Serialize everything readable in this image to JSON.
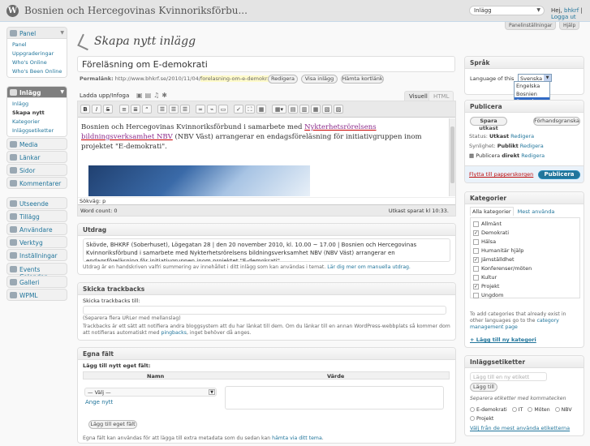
{
  "header": {
    "site_title": "Bosnien och Hercegovinas Kvinnoriksförbu...",
    "favorites_selected": "Inlägg",
    "howdy_prefix": "Hej,",
    "username": "bhkrf",
    "separator": "|",
    "logout": "Logga ut",
    "screen_options": "Panelinställningar",
    "help": "Hjälp"
  },
  "menu": {
    "panel": {
      "label": "Panel",
      "items": [
        "Panel",
        "Uppgraderingar",
        "Who's Online",
        "Who's Been Online"
      ]
    },
    "posts": {
      "label": "Inlägg",
      "items": [
        "Inlägg",
        "Skapa nytt",
        "Kategorier",
        "Inläggsetiketter"
      ]
    },
    "media": "Media",
    "links": "Länkar",
    "pages": "Sidor",
    "comments": "Kommentarer",
    "appearance": "Utseende",
    "plugins": "Tillägg",
    "users": "Användare",
    "tools": "Verktyg",
    "settings": "Inställningar",
    "events": "Events Calendar",
    "gallery": "Galleri",
    "wpml": "WPML"
  },
  "page": {
    "title": "Skapa nytt inlägg",
    "post_title": "Föreläsning om E-demokrati",
    "permalink_label": "Permalänk:",
    "permalink_base": "http://www.bhkrf.se/2010/11/04/",
    "permalink_slug": "forelasning-om-e-demokrati",
    "permalink_end": "/",
    "edit_btn": "Redigera",
    "view_btn": "Visa inlägg",
    "shortlink_btn": "Hämta kortlänk",
    "upload_label": "Ladda upp/Infoga",
    "tab_visual": "Visuell",
    "tab_html": "HTML"
  },
  "editor": {
    "content_1": "Bosnien och Hercegovinas Kvinnoriksförbund i samarbete med",
    "content_link": "Nykterhetsrörelsens bildningsverksamhet NBV",
    "content_2": "(NBV Väst) arrangerar en endagsföreläsning för initiativgruppen inom projektet \"E-demokrati\".",
    "path": "Sökväg: p",
    "word_count": "Word count: 0",
    "draft_saved": "Utkast sparat kl 10:33."
  },
  "excerpt": {
    "title": "Utdrag",
    "text": "Skövde, BHKRF (Soberhuset), Lögegatan 28 | den 20 november 2010, kl. 10.00 ~ 17.00 | Bosnien och Hercegovinas Kvinnoriksförbund i samarbete med Nykterhetsrörelsens bildningsverksamhet NBV (NBV Väst) arrangerar en endagsföreläsning för initiativgruppen inom projektet \"E-demokrati\".",
    "note": "Utdrag är en handskriven valfri summering av innehållet i ditt inlägg som kan användas i temat.",
    "note_link": "Lär dig mer om manuella utdrag."
  },
  "trackbacks": {
    "title": "Skicka trackbacks",
    "label": "Skicka trackbacks till:",
    "hint": "(Separera flera URLer med mellanslag)",
    "note": "Trackbacks är ett sätt att notifiera andra bloggsystem att du har länkat till dem. Om du länkar till en annan WordPress-webbplats så kommer dom att notifieras automatiskt med",
    "note_link": "pingbacks",
    "note_end": ", inget behöver då anges."
  },
  "custom_fields": {
    "title": "Egna fält",
    "add_heading": "Lägg till nytt eget fält:",
    "col_name": "Namn",
    "col_value": "Värde",
    "select_value": "— Välj —",
    "enter_new": "Ange nytt",
    "add_btn": "Lägg till eget fält",
    "note": "Egna fält kan användas för att lägga till extra metadata som du sedan kan",
    "note_link": "hämta via ditt tema",
    "note_end": "."
  },
  "language": {
    "title": "Språk",
    "label": "Language of this",
    "selected": "Svenska",
    "options": [
      "Engelska",
      "Bosnien",
      "Svenska"
    ]
  },
  "publish": {
    "title": "Publicera",
    "save_draft": "Spara utkast",
    "preview": "Förhandsgranska",
    "status_label": "Status:",
    "status_value": "Utkast",
    "visibility_label": "Synlighet:",
    "visibility_value": "Publikt",
    "schedule_label": "Publicera",
    "schedule_value": "direkt",
    "edit": "Redigera",
    "trash": "Flytta till papperskorgen",
    "publish_btn": "Publicera"
  },
  "categories": {
    "title": "Kategorier",
    "tab_all": "Alla kategorier",
    "tab_popular": "Mest använda",
    "items": [
      {
        "label": "Allmänt",
        "checked": false
      },
      {
        "label": "Demokrati",
        "checked": true
      },
      {
        "label": "Hälsa",
        "checked": false
      },
      {
        "label": "Humanitär hjälp",
        "checked": false
      },
      {
        "label": "Jämställdhet",
        "checked": true
      },
      {
        "label": "Konferenser/möten",
        "checked": false
      },
      {
        "label": "Kultur",
        "checked": false
      },
      {
        "label": "Projekt",
        "checked": true
      },
      {
        "label": "Ungdom",
        "checked": false
      }
    ],
    "note": "To add categories that already exist in other languages go to the",
    "note_link": "category management page",
    "add_new": "+ Lägg till ny kategori"
  },
  "tags": {
    "title": "Inläggsetiketter",
    "placeholder": "Lägg till en ny etikett",
    "add_btn": "Lägg till",
    "hint": "Separera etiketter med kommatecken",
    "items": [
      "E-demokrati",
      "IT",
      "Möten",
      "NBV",
      "Projekt"
    ],
    "choose_link": "Välj från de mest använda etiketterna"
  },
  "icons": {
    "logo": "wordpress-logo-icon",
    "page": "pushpin-icon"
  }
}
